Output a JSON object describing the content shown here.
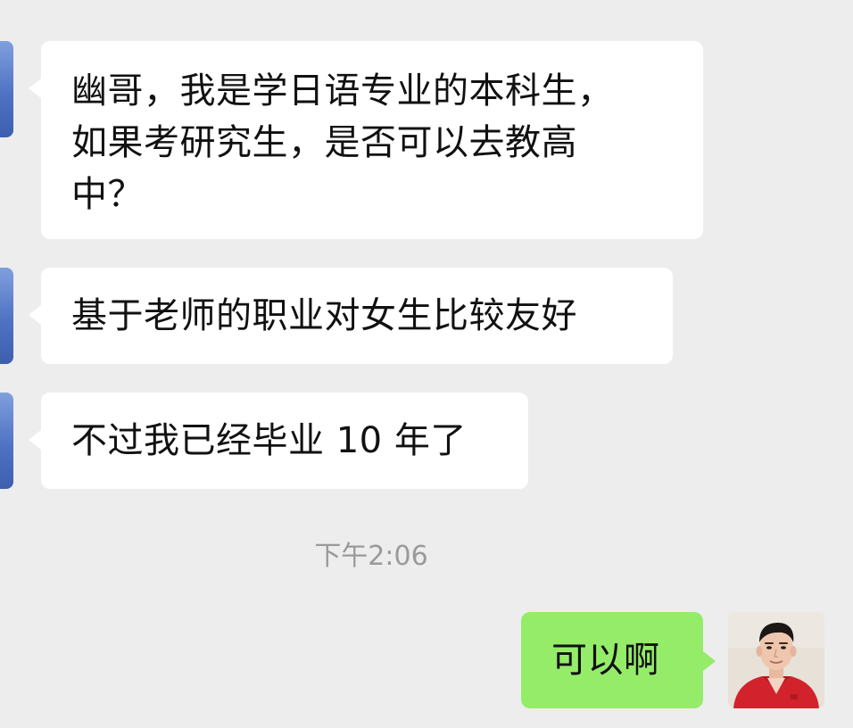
{
  "messages": {
    "incoming": [
      {
        "text": "幽哥，我是学日语专业的本科生，\n如果考研究生，是否可以去教高\n中？"
      },
      {
        "text": "基于老师的职业对女生比较友好"
      },
      {
        "text": "不过我已经毕业 10 年了"
      }
    ],
    "timestamp": "下午2:06",
    "outgoing": [
      {
        "text": "可以啊"
      }
    ]
  },
  "colors": {
    "background": "#ededed",
    "incoming_bubble": "#ffffff",
    "outgoing_bubble": "#95ec69",
    "timestamp": "#9a9a9a"
  },
  "icons": {
    "sender_avatar": "avatar",
    "self_avatar": "avatar"
  }
}
